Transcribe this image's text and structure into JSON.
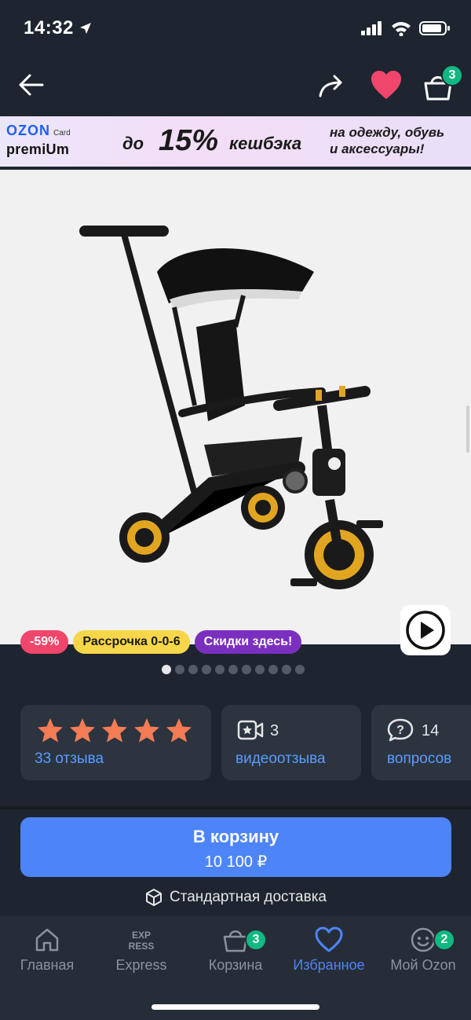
{
  "status": {
    "time": "14:32"
  },
  "header": {
    "cart_count": "3"
  },
  "banner": {
    "brand": "OZON",
    "card": "Card",
    "premium": "premiUm",
    "prefix": "до",
    "percent": "15%",
    "cashback": "кешбэка",
    "right_line1": "на одежду, обувь",
    "right_line2": "и аксессуары!"
  },
  "tags": [
    {
      "label": "-59%",
      "bg": "#f0466b",
      "color": "#ffffff"
    },
    {
      "label": "Рассрочка 0-0-6",
      "bg": "#f7d74a",
      "color": "#1a1a1a"
    },
    {
      "label": "Скидки здесь!",
      "bg": "#7b2fbf",
      "color": "#ffffff"
    }
  ],
  "gallery": {
    "total_images": 11,
    "active_index": 0
  },
  "rating": {
    "stars": 5,
    "reviews_label": "33 отзыва"
  },
  "video_reviews": {
    "count": "3",
    "label": "видеоотзыва"
  },
  "questions": {
    "count": "14",
    "label": "вопросов"
  },
  "cart_button": {
    "label": "В корзину",
    "price": "10 100 ₽"
  },
  "delivery": {
    "label": "Стандартная доставка"
  },
  "tabbar": {
    "home": "Главная",
    "express": "Express",
    "cart": "Корзина",
    "cart_badge": "3",
    "favorites": "Избранное",
    "profile": "Мой Ozon",
    "profile_badge": "2"
  },
  "colors": {
    "accent": "#4d84f7",
    "badge": "#10b981",
    "heart": "#f0466b",
    "star": "#f47c55"
  }
}
